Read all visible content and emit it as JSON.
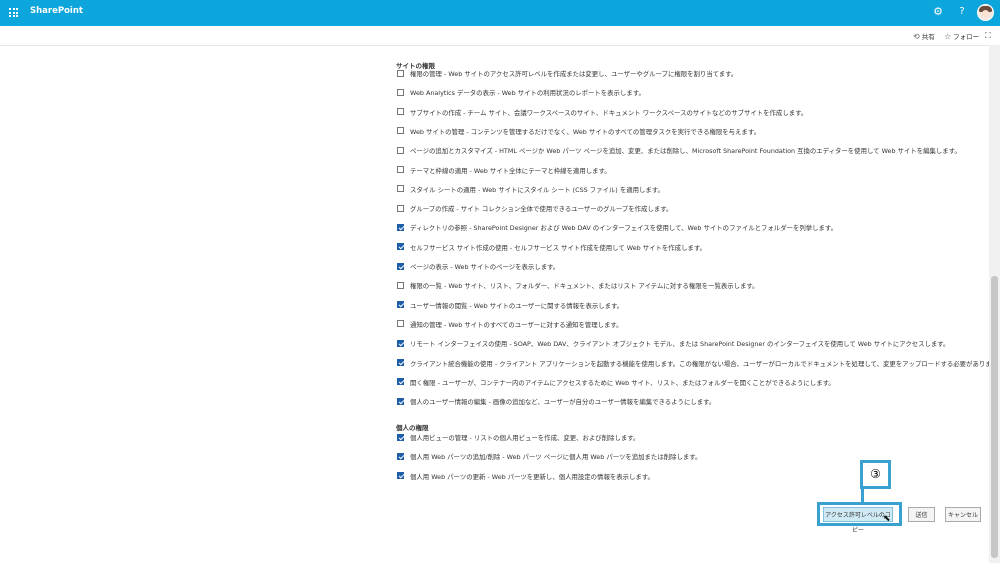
{
  "suite": {
    "brand": "SharePoint",
    "settings_icon": "gear-icon",
    "help_label": "?",
    "accent": "#0ca5dc"
  },
  "commands": {
    "share": "共有",
    "follow": "フォロー"
  },
  "site_section": {
    "title": "サイトの権限",
    "items": [
      {
        "checked": false,
        "text": "権限の管理 - Web サイトのアクセス許可レベルを作成または変更し、ユーザーやグループに権限を割り当てます。"
      },
      {
        "checked": false,
        "text": "Web Analytics データの表示 - Web サイトの利用状況のレポートを表示します。"
      },
      {
        "checked": false,
        "text": "サブサイトの作成 - チーム サイト、会議ワークスペースのサイト、ドキュメント ワークスペースのサイトなどのサブサイトを作成します。"
      },
      {
        "checked": false,
        "text": "Web サイトの管理 - コンテンツを管理するだけでなく、Web サイトのすべての管理タスクを実行できる権限を与えます。"
      },
      {
        "checked": false,
        "text": "ページの追加とカスタマイズ - HTML ページか Web パーツ ページを追加、変更、または削除し、Microsoft SharePoint Foundation 互換のエディターを使用して Web サイトを編集します。"
      },
      {
        "checked": false,
        "text": "テーマと枠線の適用 - Web サイト全体にテーマと枠線を適用します。"
      },
      {
        "checked": false,
        "text": "スタイル シートの適用 - Web サイトにスタイル シート (CSS ファイル) を適用します。"
      },
      {
        "checked": false,
        "text": "グループの作成 - サイト コレクション全体で使用できるユーザーのグループを作成します。"
      },
      {
        "checked": true,
        "text": "ディレクトリの参照 - SharePoint Designer および Web DAV のインターフェイスを使用して、Web サイトのファイルとフォルダーを列挙します。"
      },
      {
        "checked": true,
        "text": "セルフサービス サイト作成の使用 - セルフサービス サイト作成を使用して Web サイトを作成します。"
      },
      {
        "checked": true,
        "text": "ページの表示 - Web サイトのページを表示します。"
      },
      {
        "checked": false,
        "text": "権限の一覧 - Web サイト、リスト、フォルダー、ドキュメント、またはリスト アイテムに対する権限を一覧表示します。"
      },
      {
        "checked": true,
        "text": "ユーザー情報の閲覧 - Web サイトのユーザーに関する情報を表示します。"
      },
      {
        "checked": false,
        "text": "通知の管理 - Web サイトのすべてのユーザーに対する通知を管理します。"
      },
      {
        "checked": true,
        "text": "リモート インターフェイスの使用 - SOAP、Web DAV、クライアント オブジェクト モデル、または SharePoint Designer のインターフェイスを使用して Web サイトにアクセスします。"
      },
      {
        "checked": true,
        "text": "クライアント統合機能の使用 - クライアント アプリケーションを起動する機能を使用します。この権限がない場合、ユーザーがローカルでドキュメントを処理して、変更をアップロードする必要があります。"
      },
      {
        "checked": true,
        "text": "開く権限 - ユーザーが、コンテナー内のアイテムにアクセスするために Web サイト、リスト、またはフォルダーを開くことができるようにします。"
      },
      {
        "checked": true,
        "text": "個人のユーザー情報の編集 - 画像の追加など、ユーザーが自分のユーザー情報を編集できるようにします。"
      }
    ]
  },
  "personal_section": {
    "title": "個人の権限",
    "items": [
      {
        "checked": true,
        "text": "個人用ビューの管理 - リストの個人用ビューを作成、変更、および削除します。"
      },
      {
        "checked": true,
        "text": "個人用 Web パーツの追加/削除 - Web パーツ ページに個人用 Web パーツを追加または削除します。"
      },
      {
        "checked": true,
        "text": "個人用 Web パーツの更新 - Web パーツを更新し、個人用設定の情報を表示します。"
      }
    ]
  },
  "buttons": {
    "copy": "アクセス許可レベルのコピー",
    "submit": "送信",
    "cancel": "キャンセル"
  },
  "annotation": {
    "step": "③",
    "color": "#39a0d0"
  }
}
